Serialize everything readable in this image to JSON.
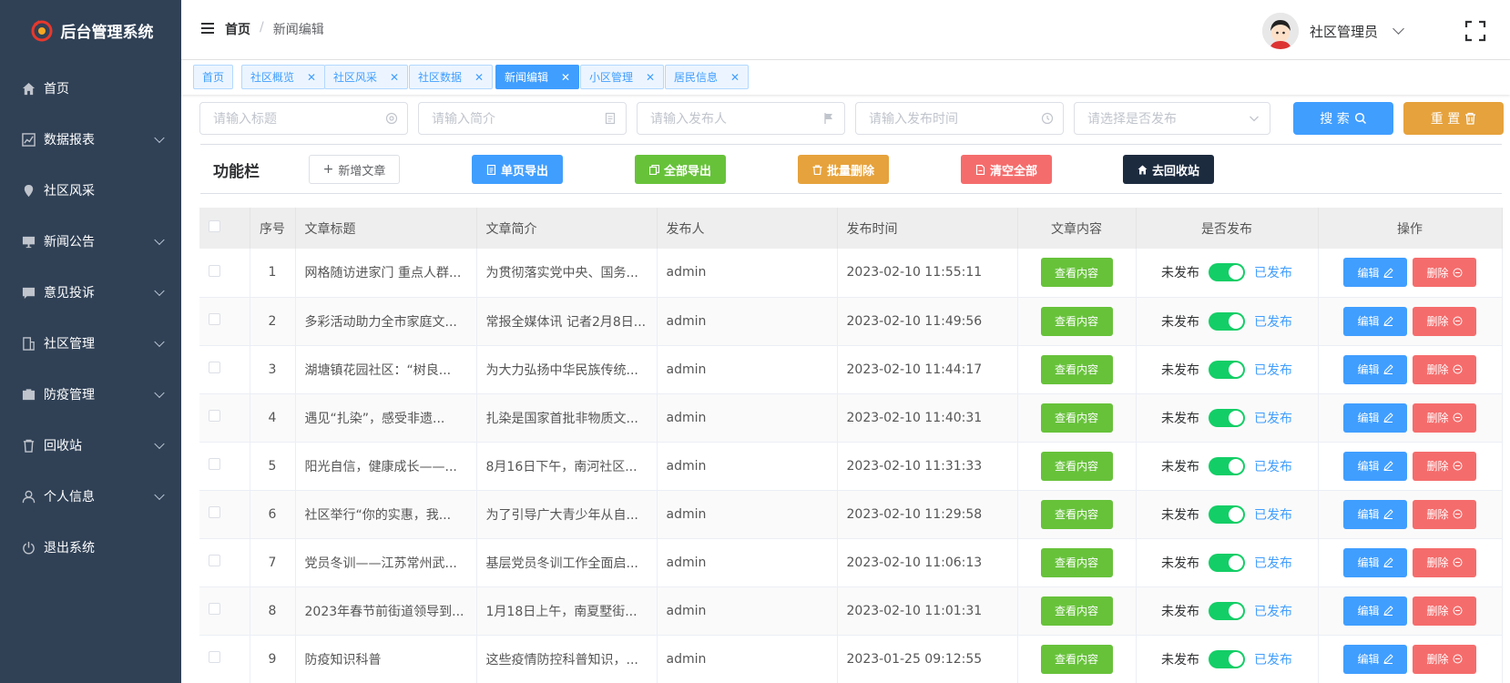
{
  "app": {
    "title": "后台管理系统"
  },
  "sidebar": {
    "items": [
      {
        "label": "首页",
        "icon": "home-icon",
        "has_children": false
      },
      {
        "label": "数据报表",
        "icon": "chart-icon",
        "has_children": true
      },
      {
        "label": "社区风采",
        "icon": "pin-icon",
        "has_children": false
      },
      {
        "label": "新闻公告",
        "icon": "monitor-icon",
        "has_children": true
      },
      {
        "label": "意见投诉",
        "icon": "chat-icon",
        "has_children": true
      },
      {
        "label": "社区管理",
        "icon": "building-icon",
        "has_children": true
      },
      {
        "label": "防疫管理",
        "icon": "briefcase-icon",
        "has_children": true
      },
      {
        "label": "回收站",
        "icon": "trash-icon",
        "has_children": true
      },
      {
        "label": "个人信息",
        "icon": "user-icon",
        "has_children": true
      },
      {
        "label": "退出系统",
        "icon": "power-icon",
        "has_children": false
      }
    ]
  },
  "header": {
    "breadcrumb_home": "首页",
    "breadcrumb_sep": "/",
    "breadcrumb_current": "新闻编辑",
    "user_name": "社区管理员"
  },
  "tags": [
    {
      "label": "首页",
      "closable": false,
      "active": false
    },
    {
      "label": "社区概览",
      "closable": true,
      "active": false
    },
    {
      "label": "社区风采",
      "closable": true,
      "active": false
    },
    {
      "label": "社区数据",
      "closable": true,
      "active": false
    },
    {
      "label": "新闻编辑",
      "closable": true,
      "active": true
    },
    {
      "label": "小区管理",
      "closable": true,
      "active": false
    },
    {
      "label": "居民信息",
      "closable": true,
      "active": false
    }
  ],
  "search": {
    "title_placeholder": "请输入标题",
    "summary_placeholder": "请输入简介",
    "publisher_placeholder": "请输入发布人",
    "time_placeholder": "请输入发布时间",
    "published_placeholder": "请选择是否发布",
    "search_label": "搜 索",
    "reset_label": "重 置"
  },
  "toolbar": {
    "title": "功能栏",
    "add_label": "新增文章",
    "export_page_label": "单页导出",
    "export_all_label": "全部导出",
    "batch_delete_label": "批量删除",
    "clear_all_label": "清空全部",
    "recycle_label": "去回收站"
  },
  "table": {
    "headers": {
      "index": "序号",
      "title": "文章标题",
      "summary": "文章简介",
      "publisher": "发布人",
      "time": "发布时间",
      "content": "文章内容",
      "published": "是否发布",
      "actions": "操作"
    },
    "view_label": "查看内容",
    "unpublished_label": "未发布",
    "published_label": "已发布",
    "edit_label": "编辑",
    "delete_label": "删除",
    "rows": [
      {
        "index": "1",
        "title": "网格随访进家门 重点人群...",
        "summary": "为贯彻落实党中央、国务...",
        "publisher": "admin",
        "time": "2023-02-10 11:55:11"
      },
      {
        "index": "2",
        "title": "多彩活动助力全市家庭文...",
        "summary": "常报全媒体讯 记者2月8日...",
        "publisher": "admin",
        "time": "2023-02-10 11:49:56"
      },
      {
        "index": "3",
        "title": "湖塘镇花园社区：“树良...",
        "summary": "为大力弘扬中华民族传统...",
        "publisher": "admin",
        "time": "2023-02-10 11:44:17"
      },
      {
        "index": "4",
        "title": "遇见“扎染”，感受非遗...",
        "summary": "扎染是国家首批非物质文...",
        "publisher": "admin",
        "time": "2023-02-10 11:40:31"
      },
      {
        "index": "5",
        "title": "阳光自信，健康成长——...",
        "summary": "8月16日下午，南河社区...",
        "publisher": "admin",
        "time": "2023-02-10 11:31:33"
      },
      {
        "index": "6",
        "title": "社区举行“你的实惠，我...",
        "summary": "为了引导广大青少年从自...",
        "publisher": "admin",
        "time": "2023-02-10 11:29:58"
      },
      {
        "index": "7",
        "title": "党员冬训——江苏常州武...",
        "summary": "基层党员冬训工作全面启...",
        "publisher": "admin",
        "time": "2023-02-10 11:06:13"
      },
      {
        "index": "8",
        "title": "2023年春节前街道领导到...",
        "summary": "1月18日上午，南夏墅街...",
        "publisher": "admin",
        "time": "2023-02-10 11:01:31"
      },
      {
        "index": "9",
        "title": "防疫知识科普",
        "summary": "这些疫情防控科普知识，...",
        "publisher": "admin",
        "time": "2023-01-25 09:12:55"
      }
    ]
  },
  "colors": {
    "sidebar_bg": "#304156",
    "primary": "#409eff",
    "success": "#67c23a",
    "warning": "#e6a23c",
    "danger": "#f56c6c",
    "dark": "#1d2b3f",
    "switch_on": "#13ce66"
  }
}
